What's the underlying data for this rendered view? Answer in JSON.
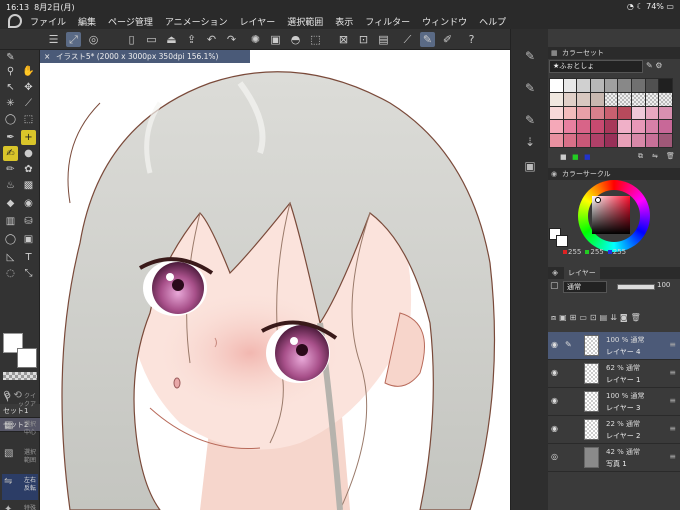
{
  "status": {
    "time": "16:13",
    "date": "8月2日(月)",
    "battery": "74%"
  },
  "menu": [
    "ファイル",
    "編集",
    "ページ管理",
    "アニメーション",
    "レイヤー",
    "選択範囲",
    "表示",
    "フィルター",
    "ウィンドウ",
    "ヘルプ"
  ],
  "document": {
    "tab_title": "イラスト5* (2000 x 3000px 350dpi 156.1%)",
    "close_glyph": "×"
  },
  "tool_sets": {
    "tabs": [
      "セット1",
      "セット2"
    ],
    "buttons": [
      {
        "label": "クイ\nックア",
        "icon": "⚲"
      },
      {
        "label": "選択\n中心",
        "icon": "▦"
      },
      {
        "label": "選択\n範囲",
        "icon": "▧"
      },
      {
        "label": "左右\n反転",
        "icon": "⇋"
      },
      {
        "label": "特殊",
        "icon": "✦"
      }
    ]
  },
  "color_set": {
    "title": "カラーセット",
    "selected_set": "★ふぉとしょ",
    "swatches": [
      "#ffffff",
      "#e8e8e8",
      "#d0d0d0",
      "#b8b8b8",
      "#a0a0a0",
      "#888888",
      "#707070",
      "#505050",
      "#202020",
      "#f0e8e0",
      "#e0d0c8",
      "#d8c8c0",
      "#c8b8b0",
      "tp",
      "tp",
      "tp",
      "tp",
      "tp",
      "#f7d8d8",
      "#f2bcbc",
      "#e8a0a8",
      "#d8808c",
      "#c96070",
      "#b84a5c",
      "#f0c8d8",
      "#e8a8c0",
      "#d890b0",
      "#f5a8b8",
      "#e880a0",
      "#d86488",
      "#c84a70",
      "#a8385a",
      "#f0b0c8",
      "#e898b8",
      "#d880a8",
      "#c86898",
      "#e890a0",
      "#d87088",
      "#c85878",
      "#b04068",
      "#983058",
      "#e8a0b8",
      "#d888a8",
      "#c87098",
      "#a05878"
    ]
  },
  "color_circle": {
    "title": "カラーサークル",
    "r": "255",
    "g": "255",
    "b": "255"
  },
  "layer_panel": {
    "title": "レイヤー",
    "blend_mode": "通常",
    "opacity": "100",
    "layers": [
      {
        "opacity_mode": "100 % 通常",
        "name": "レイヤー 4",
        "selected": true
      },
      {
        "opacity_mode": "62 % 通常",
        "name": "レイヤー 1",
        "selected": false
      },
      {
        "opacity_mode": "100 % 通常",
        "name": "レイヤー 3",
        "selected": false
      },
      {
        "opacity_mode": "22 % 通常",
        "name": "レイヤー 2",
        "selected": false
      },
      {
        "opacity_mode": "42 % 通常",
        "name": "写真 1",
        "selected": false
      }
    ]
  }
}
